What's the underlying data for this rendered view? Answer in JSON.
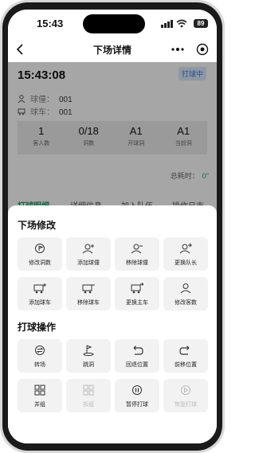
{
  "status_bar": {
    "time": "15:43",
    "battery": "89"
  },
  "nav": {
    "title": "下场详情"
  },
  "header": {
    "time": "15:43:08",
    "status_badge": "打球中",
    "caddie_label": "球僮：",
    "caddie_value": "001",
    "cart_label": "球车：",
    "cart_value": "001"
  },
  "stats": [
    {
      "value": "1",
      "label": "客人数"
    },
    {
      "value": "0/18",
      "label": "洞数"
    },
    {
      "value": "A1",
      "label": "开球洞"
    },
    {
      "value": "A1",
      "label": "当前洞"
    }
  ],
  "total": {
    "label": "总耗时：",
    "value": "0\""
  },
  "tabs": [
    "打球明细",
    "详细信息",
    "加入队伍",
    "操作日志"
  ],
  "sheet": {
    "section1_title": "下场修改",
    "section1_items": [
      {
        "label": "修改洞数",
        "icon": "flag-edit-icon",
        "disabled": false
      },
      {
        "label": "添加球僮",
        "icon": "person-add-icon",
        "disabled": false
      },
      {
        "label": "移除球僮",
        "icon": "person-remove-icon",
        "disabled": false
      },
      {
        "label": "更换队长",
        "icon": "person-switch-icon",
        "disabled": false
      },
      {
        "label": "添加球车",
        "icon": "cart-add-icon",
        "disabled": false
      },
      {
        "label": "移除球车",
        "icon": "cart-remove-icon",
        "disabled": false
      },
      {
        "label": "更换主车",
        "icon": "cart-switch-icon",
        "disabled": false
      },
      {
        "label": "修改客数",
        "icon": "person-icon",
        "disabled": false
      }
    ],
    "section2_title": "打球操作",
    "section2_items": [
      {
        "label": "转场",
        "icon": "transfer-icon",
        "disabled": false
      },
      {
        "label": "跳洞",
        "icon": "skip-hole-icon",
        "disabled": false
      },
      {
        "label": "回退位置",
        "icon": "undo-icon",
        "disabled": false
      },
      {
        "label": "前移位置",
        "icon": "redo-icon",
        "disabled": false
      },
      {
        "label": "并组",
        "icon": "merge-icon",
        "disabled": false
      },
      {
        "label": "拆组",
        "icon": "split-icon",
        "disabled": true
      },
      {
        "label": "暂停打球",
        "icon": "pause-icon",
        "disabled": false
      },
      {
        "label": "恢复打球",
        "icon": "resume-icon",
        "disabled": true
      }
    ]
  },
  "colors": {
    "accent": "#1f9a6a",
    "badge": "#3b7bd6"
  }
}
